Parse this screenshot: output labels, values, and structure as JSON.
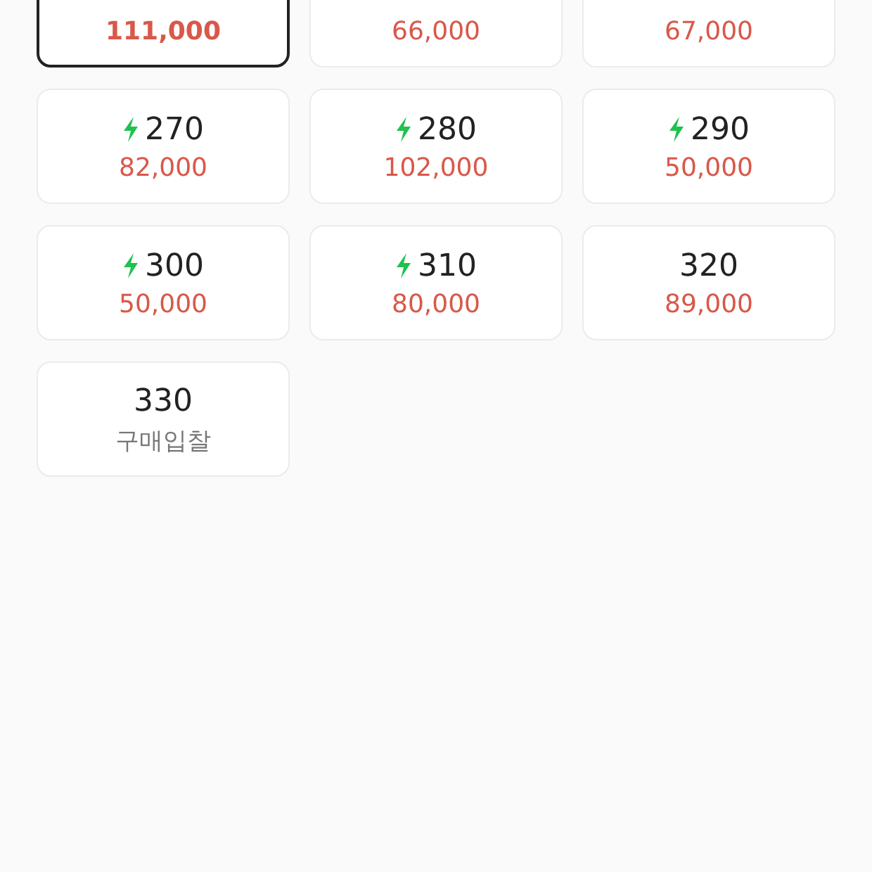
{
  "sizes": [
    {
      "price": "111,000",
      "kind": "price",
      "selected": true
    },
    {
      "price": "66,000",
      "kind": "price",
      "selected": false
    },
    {
      "price": "67,000",
      "kind": "price",
      "selected": false
    },
    {
      "size": "270",
      "fast": true,
      "price": "82,000",
      "kind": "price",
      "selected": false
    },
    {
      "size": "280",
      "fast": true,
      "price": "102,000",
      "kind": "price",
      "selected": false
    },
    {
      "size": "290",
      "fast": true,
      "price": "50,000",
      "kind": "price",
      "selected": false
    },
    {
      "size": "300",
      "fast": true,
      "price": "50,000",
      "kind": "price",
      "selected": false
    },
    {
      "size": "310",
      "fast": true,
      "price": "80,000",
      "kind": "price",
      "selected": false
    },
    {
      "size": "320",
      "fast": false,
      "price": "89,000",
      "kind": "price",
      "selected": false
    },
    {
      "size": "330",
      "fast": false,
      "price": "구매입찰",
      "kind": "bid",
      "selected": false
    }
  ]
}
